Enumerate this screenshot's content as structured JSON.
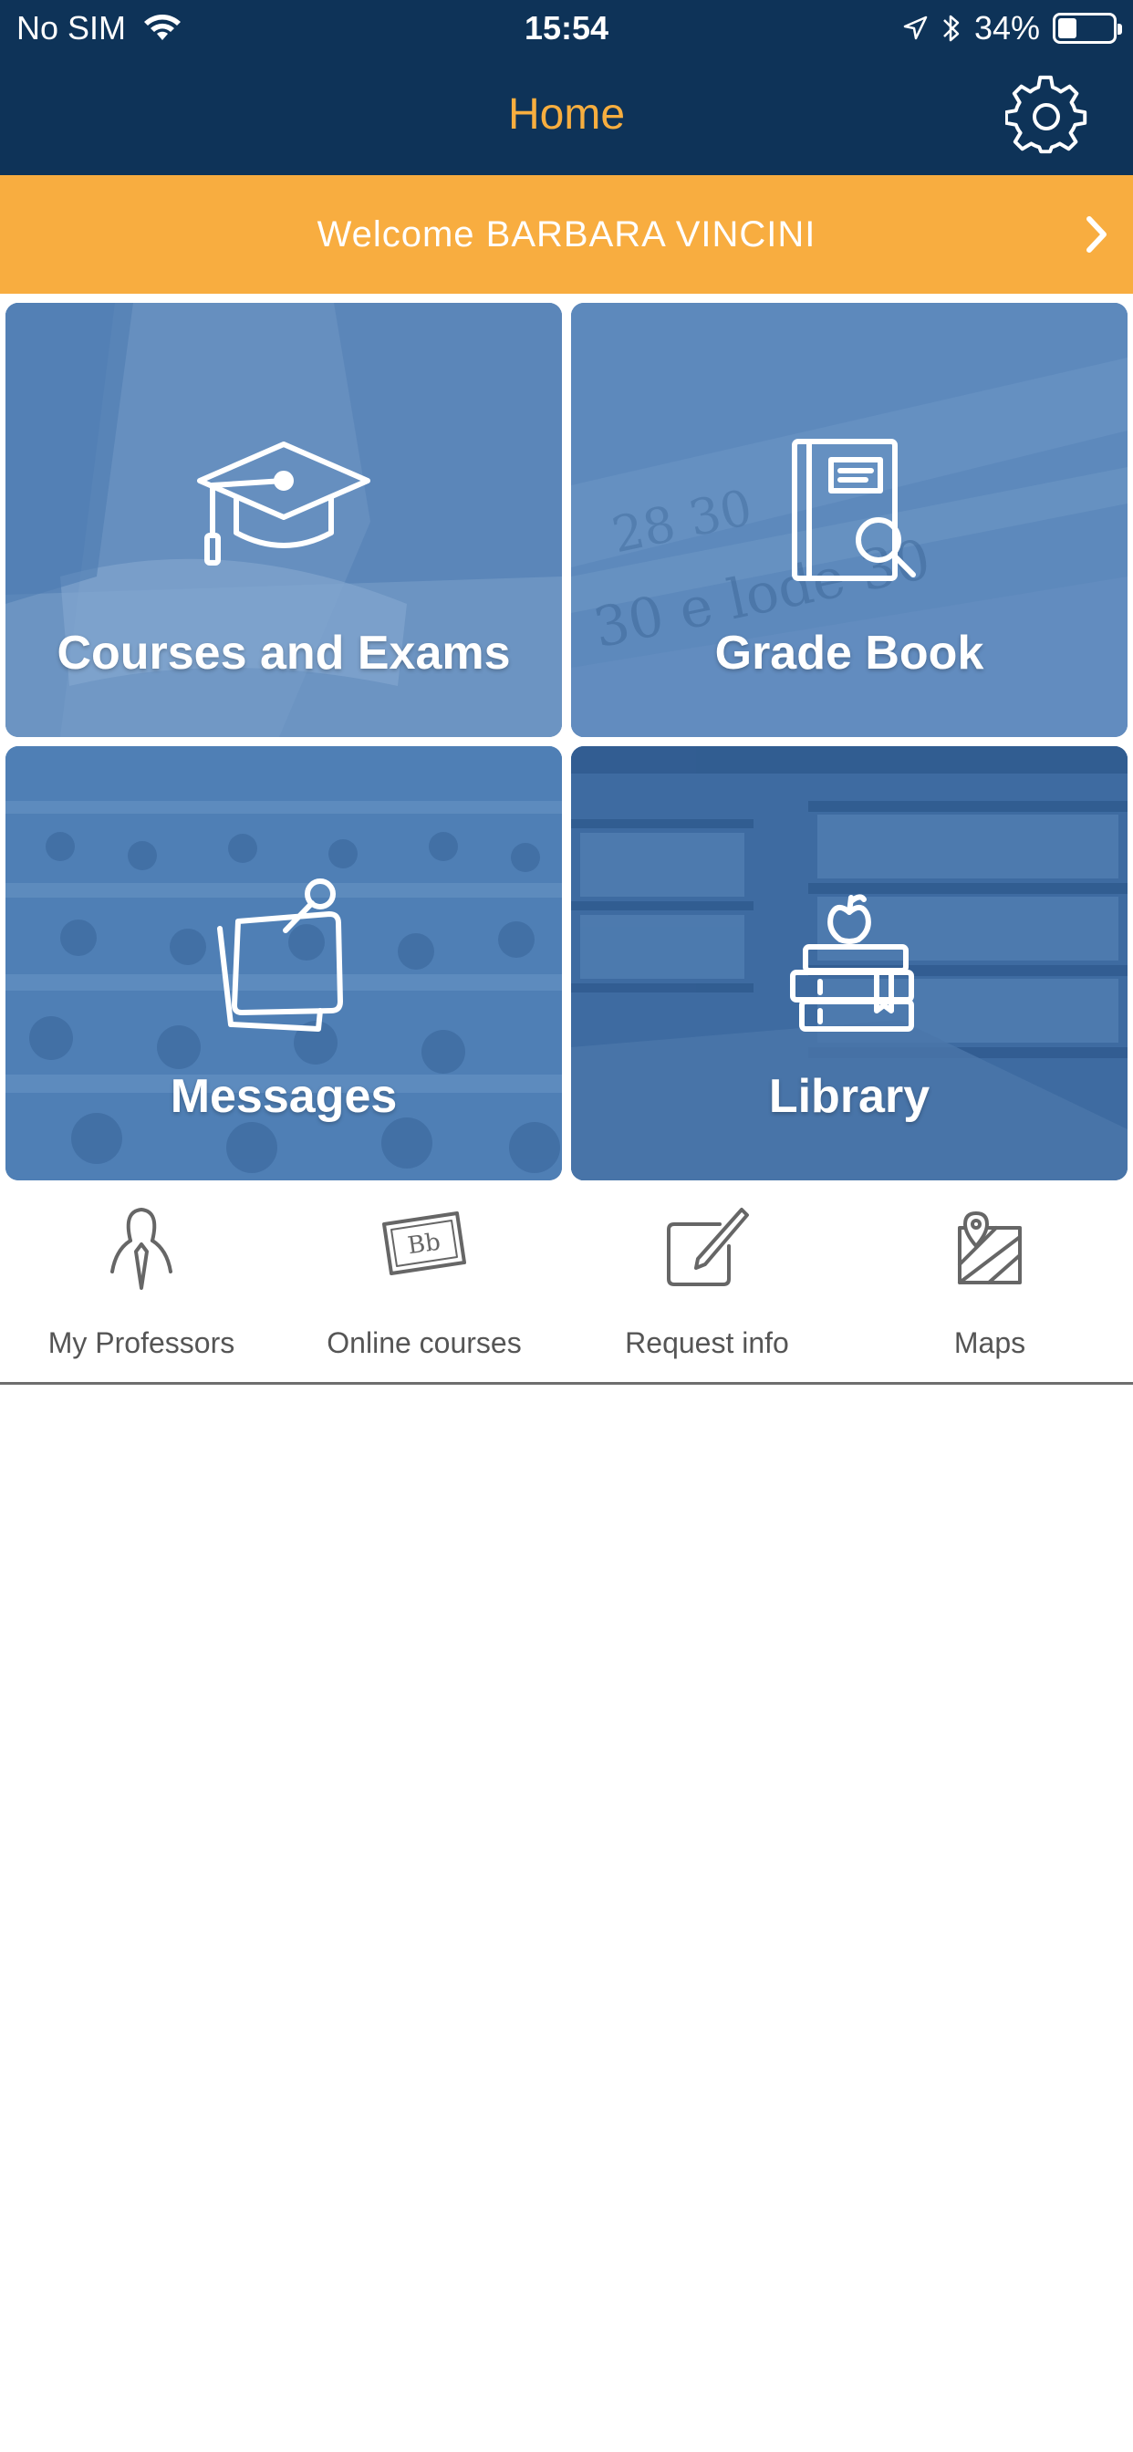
{
  "status_bar": {
    "carrier": "No SIM",
    "time": "15:54",
    "battery": "34%",
    "battery_level": 0.34
  },
  "nav": {
    "title": "Home",
    "settings_icon": "gear-icon",
    "title_color": "#f7ae3f",
    "bar_color": "#0e3358"
  },
  "welcome": {
    "text": "Welcome BARBARA VINCINI",
    "color": "#f8ad40"
  },
  "tiles": [
    {
      "label": "Courses and Exams",
      "icon": "graduation-cap-icon"
    },
    {
      "label": "Grade Book",
      "icon": "notebook-search-icon"
    },
    {
      "label": "Messages",
      "icon": "sticky-notes-icon"
    },
    {
      "label": "Library",
      "icon": "books-apple-icon"
    }
  ],
  "shortcuts": [
    {
      "label": "My Professors",
      "icon": "professor-icon"
    },
    {
      "label": "Online courses",
      "icon": "blackboard-icon"
    },
    {
      "label": "Request info",
      "icon": "edit-icon"
    },
    {
      "label": "Maps",
      "icon": "map-icon"
    }
  ]
}
